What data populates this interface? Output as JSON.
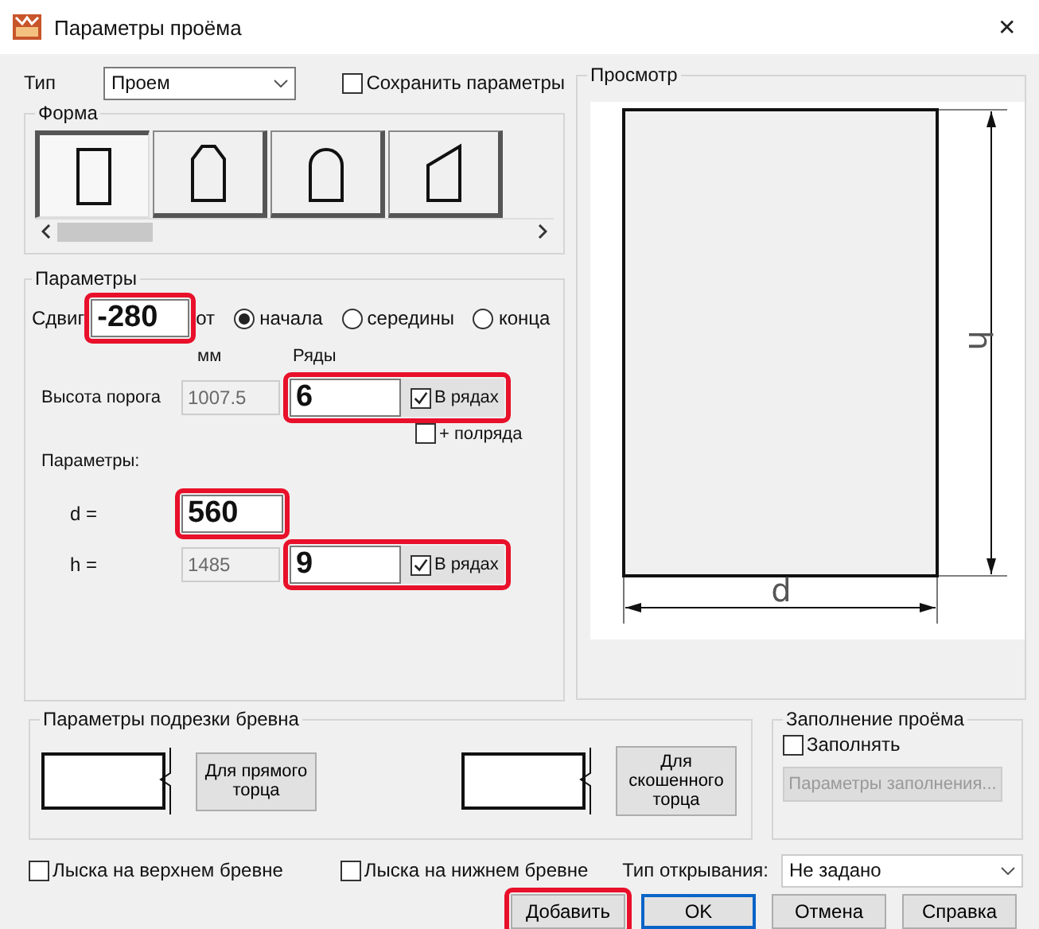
{
  "window": {
    "title": "Параметры проёма",
    "close": "✕"
  },
  "type_field": {
    "label": "Тип",
    "value": "Проем"
  },
  "save_params": {
    "label": "Сохранить параметры",
    "checked": false
  },
  "shape_group": {
    "title": "Форма",
    "shapes": [
      {
        "kind": "rect",
        "selected": true
      },
      {
        "kind": "chamfer",
        "selected": false
      },
      {
        "kind": "arch",
        "selected": false
      },
      {
        "kind": "slant",
        "selected": false
      }
    ]
  },
  "params": {
    "title": "Параметры",
    "shift_label": "Сдвиг",
    "shift": {
      "value": "-280",
      "highlighted": true
    },
    "from_label": "от",
    "unit": "мм",
    "rows_header": "Ряды",
    "anchor_options": [
      {
        "label": "начала",
        "selected": true
      },
      {
        "label": "середины",
        "selected": false
      },
      {
        "label": "конца",
        "selected": false
      }
    ],
    "sill": {
      "label": "Высота порога",
      "value": "1007.5",
      "disabled": true,
      "rows": "6",
      "in_rows": {
        "label": "В рядах",
        "checked": true
      },
      "highlighted": true
    },
    "half_row": {
      "label": "+ полряда",
      "checked": false
    },
    "sub_title": "Параметры:",
    "d": {
      "label": "d =",
      "value": "560",
      "highlighted": true
    },
    "h": {
      "label": "h =",
      "value": "1485",
      "disabled": true,
      "rows": "9",
      "in_rows": {
        "label": "В рядах",
        "checked": true
      },
      "highlighted": true
    }
  },
  "preview": {
    "title": "Просмотр",
    "width_label": "d",
    "height_label": "h"
  },
  "trim": {
    "title": "Параметры подрезки бревна",
    "buttons": [
      {
        "label": "Для прямого торца"
      },
      {
        "label": "Для скошенного торца"
      }
    ]
  },
  "fill": {
    "title": "Заполнение проёма",
    "fill_check": {
      "label": "Заполнять",
      "checked": false
    },
    "button": {
      "label": "Параметры заполнения...",
      "disabled": true
    }
  },
  "flat_top": {
    "label": "Лыска на верхнем бревне",
    "checked": false
  },
  "flat_bottom": {
    "label": "Лыска на нижнем бревне",
    "checked": false
  },
  "opening_type": {
    "label": "Тип открывания:",
    "value": "Не задано"
  },
  "buttons": [
    {
      "label": "Добавить",
      "default": false,
      "highlighted": true
    },
    {
      "label": "OK",
      "default": true,
      "highlighted": false
    },
    {
      "label": "Отмена",
      "default": false,
      "highlighted": false
    },
    {
      "label": "Справка",
      "default": false,
      "highlighted": false
    }
  ]
}
